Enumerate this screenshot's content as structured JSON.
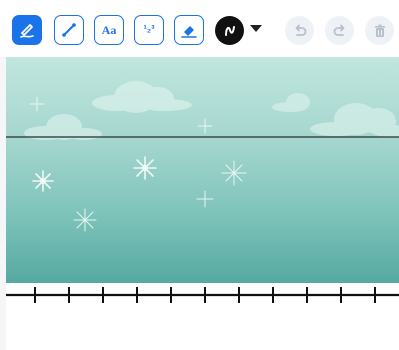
{
  "toolbar": {
    "tools": [
      {
        "name": "pen",
        "active": true
      },
      {
        "name": "line",
        "active": false
      },
      {
        "name": "text",
        "label": "Aa",
        "active": false
      },
      {
        "name": "numbers",
        "label": "¹₂³",
        "active": false
      },
      {
        "name": "eraser",
        "active": false
      }
    ],
    "color": "#111111",
    "accent": "#1a73e8"
  },
  "icons": {
    "pen": "pen-icon",
    "line": "line-tool-icon",
    "eraser": "eraser-icon",
    "color": "color-picker-icon",
    "undo": "undo-icon",
    "redo": "redo-icon",
    "trash": "trash-icon"
  }
}
